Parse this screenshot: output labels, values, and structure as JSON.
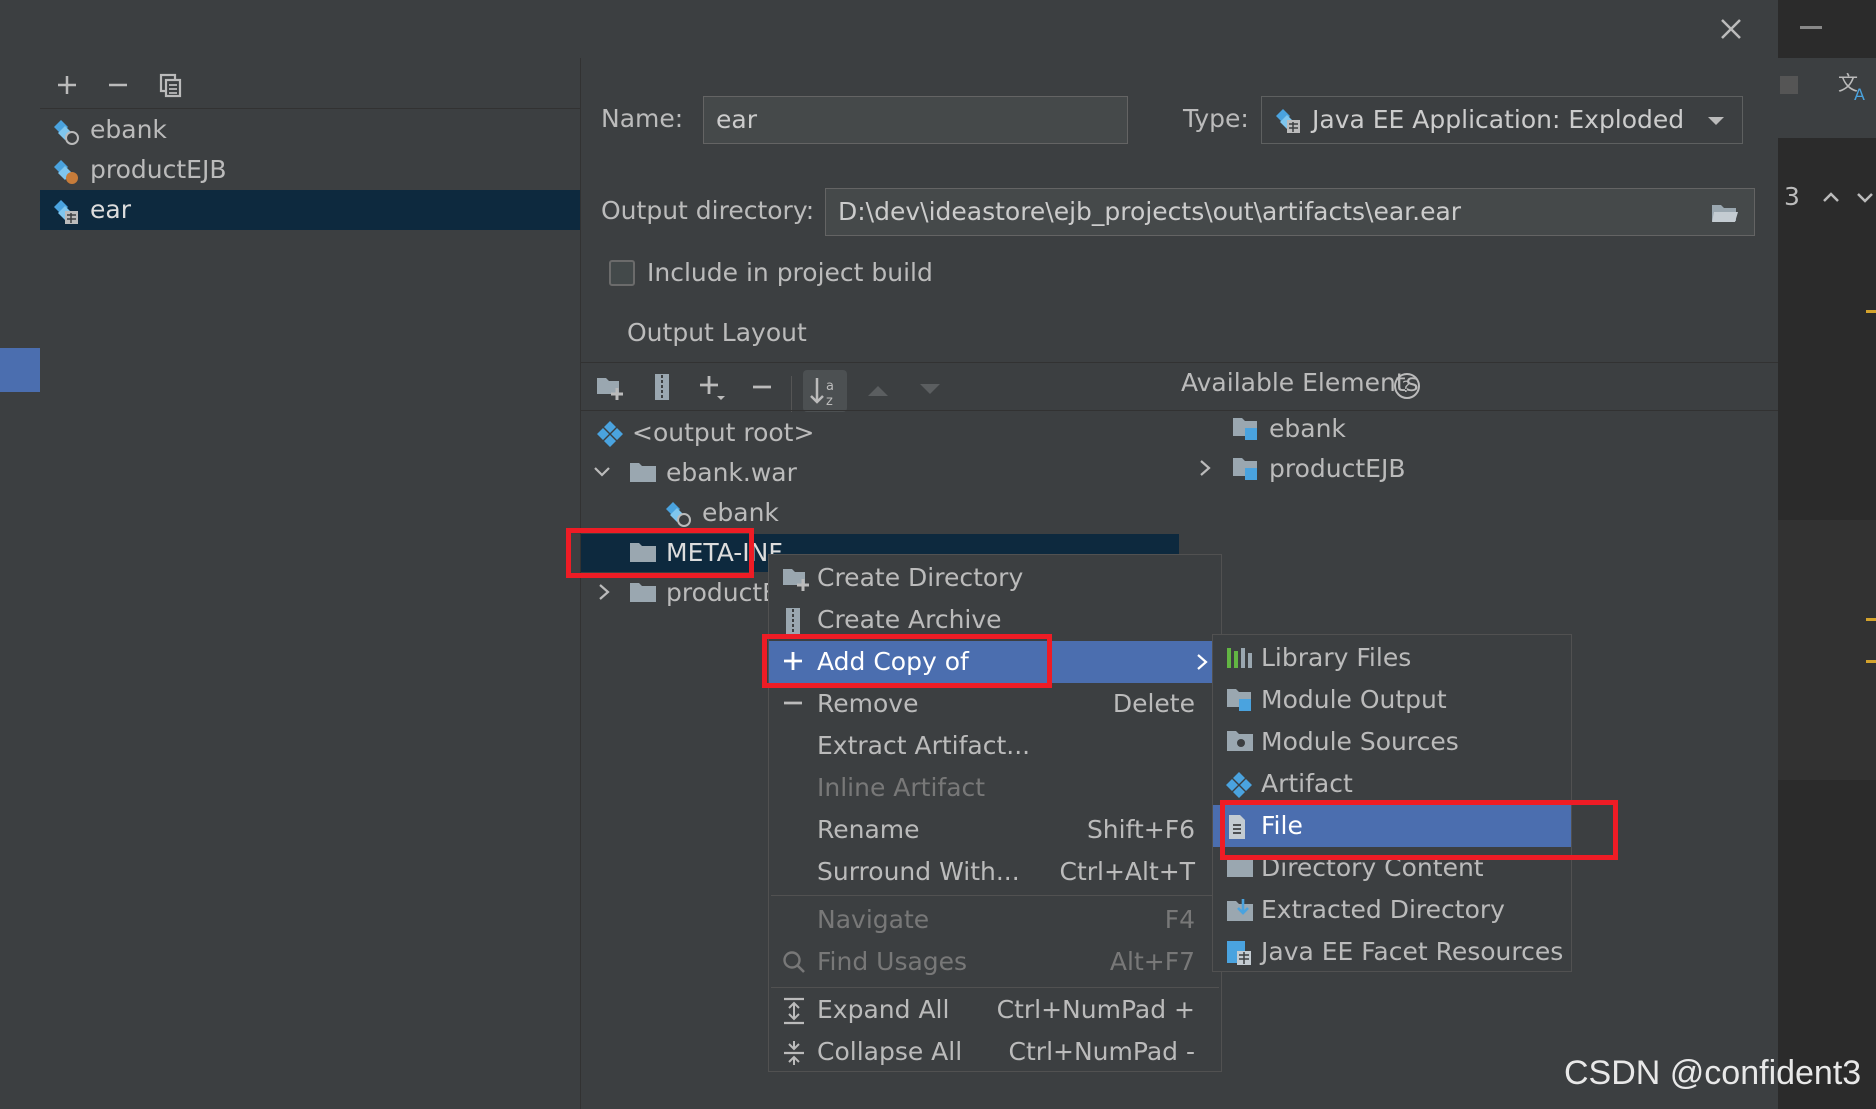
{
  "left_panel": {
    "items": [
      {
        "label": "ebank"
      },
      {
        "label": "productEJB"
      },
      {
        "label": "ear"
      }
    ]
  },
  "form": {
    "name_label": "Name:",
    "name_value": "ear",
    "type_label": "Type:",
    "type_value": "Java EE Application: Exploded",
    "output_dir_label": "Output directory:",
    "output_dir_value": "D:\\dev\\ideastore\\ejb_projects\\out\\artifacts\\ear.ear",
    "include_label": "Include in project build",
    "output_layout_tab": "Output Layout"
  },
  "tree": {
    "output_root": "<output root>",
    "ebank_war": "ebank.war",
    "ebank": "ebank",
    "meta_inf": "META-INF",
    "product": "productEJB"
  },
  "available": {
    "title": "Available Elements",
    "items": [
      {
        "label": "ebank"
      },
      {
        "label": "productEJB"
      }
    ]
  },
  "context_menu": {
    "create_directory": "Create Directory",
    "create_archive": "Create Archive",
    "add_copy_of": "Add Copy of",
    "remove": "Remove",
    "remove_shortcut": "Delete",
    "extract_artifact": "Extract Artifact...",
    "inline_artifact": "Inline Artifact",
    "rename": "Rename",
    "rename_shortcut": "Shift+F6",
    "surround_with": "Surround With...",
    "surround_shortcut": "Ctrl+Alt+T",
    "navigate": "Navigate",
    "navigate_shortcut": "F4",
    "find_usages": "Find Usages",
    "find_usages_shortcut": "Alt+F7",
    "expand_all": "Expand All",
    "expand_shortcut": "Ctrl+NumPad +",
    "collapse_all": "Collapse All",
    "collapse_shortcut": "Ctrl+NumPad -"
  },
  "submenu": {
    "library_files": "Library Files",
    "module_output": "Module Output",
    "module_sources": "Module Sources",
    "artifact": "Artifact",
    "file": "File",
    "directory_content": "Directory Content",
    "extracted_directory": "Extracted Directory",
    "java_ee_facet": "Java EE Facet Resources"
  },
  "editor_side": {
    "counter": "3"
  },
  "watermark": "CSDN @confident3",
  "colors": {
    "selection": "#4b6eaf",
    "highlight_box": "#ee1c25",
    "tree_selected": "#0d293e"
  }
}
